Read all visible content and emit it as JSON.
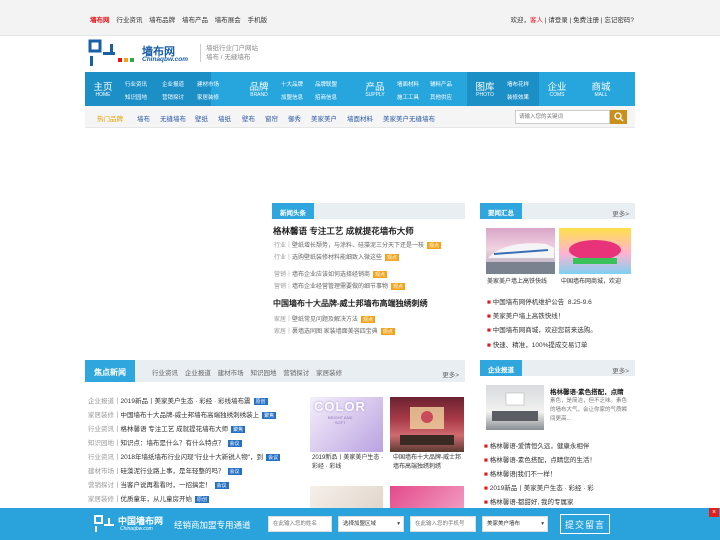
{
  "topbar": {
    "links": [
      "墙布网",
      "行业资讯",
      "墙布品牌",
      "墙布产品",
      "墙布展会",
      "手机版"
    ],
    "welcome": "欢迎，",
    "guest": "客人",
    "sep1": "| 请登录 |",
    "register": "免费注册",
    "forgot": "| 忘记密码?"
  },
  "logo": {
    "cn": "墙布网",
    "en": "Chinaqbw.com",
    "slogan_1": "墙纸行业门户网站",
    "slogan_2": "墙布 / 无缝墙布"
  },
  "nav": [
    {
      "label": "主页",
      "sub": "HOME",
      "items": [
        "行业资讯",
        "企业报道",
        "建材市场",
        "知识园地",
        "营销探讨",
        "家居装修"
      ]
    },
    {
      "label": "品牌",
      "sub": "BRAND",
      "items": [
        "十大品牌",
        "品牌联盟",
        "加盟信息",
        "招商信息"
      ]
    },
    {
      "label": "产品",
      "sub": "SUPPLY",
      "items": [
        "墙面材料",
        "辅料产品",
        "施工工具",
        "其他供应"
      ]
    },
    {
      "label": "图库",
      "sub": "PHOTO",
      "items": [
        "墙布花样",
        "装修效果"
      ]
    },
    {
      "label": "企业",
      "sub": "COMS",
      "items": []
    },
    {
      "label": "商城",
      "sub": "MALL",
      "items": []
    }
  ],
  "subnav": {
    "hot": "热门品牌",
    "items": [
      "墙布",
      "无缝墙布",
      "壁纸",
      "墙纸",
      "壁布",
      "窗帘",
      "御秀",
      "美家美户",
      "墙面材料",
      "美家美户无缝墙布"
    ],
    "search_placeholder": "请输入您的关键词"
  },
  "headline": {
    "tab": "新闻头条",
    "h1": "格林馨语 专注工艺 成就提花墙布大师",
    "rows1": [
      {
        "cat": "行业",
        "text": "壁纸增长颓势，与涂料、硅藻泥三分天下还是一枝",
        "badge": "观点"
      },
      {
        "cat": "行业",
        "text": "选购壁纸装修材料能细致入微这些",
        "badge": "观点"
      }
    ],
    "rows2": [
      {
        "cat": "营销",
        "text": "墙布企业应该如何选择经销商",
        "badge": "观点"
      },
      {
        "cat": "营销",
        "text": "墙布企业经营管理需要做的细节事物",
        "badge": "观点"
      }
    ],
    "h2": "中国墙布十大品牌-威士邦墙布高端独绣刺绣",
    "rows3": [
      {
        "cat": "家居",
        "text": "壁纸常见问题及解决方法",
        "badge": "观点"
      },
      {
        "cat": "家居",
        "text": "裹墙选同图 家装墙面美容四宝典",
        "badge": "观点"
      }
    ]
  },
  "roundup": {
    "tab": "要闻汇总",
    "more": "更多>",
    "caps": [
      "美家美户墙上高铁快线",
      "中国墙布网商城，欢迎"
    ],
    "items": [
      {
        "text": "中国墙布网停机维护公告",
        "date": "8.25-9.6"
      },
      {
        "text": "美家美户墙上高铁快线！",
        "date": ""
      },
      {
        "text": "中国墙布网商城，欢迎您前来选购。",
        "date": ""
      },
      {
        "text": "快速、精准，100%提成交易订单",
        "date": ""
      }
    ]
  },
  "news": {
    "tab": "焦点新闻",
    "tabs": [
      "行业资讯",
      "企业报道",
      "建材市场",
      "知识园地",
      "营销探讨",
      "家居装修"
    ],
    "more": "更多>",
    "rows": [
      {
        "cat": "企业报道",
        "text": "2019新品丨美家美户生态 · 彩经 · 彩线墙布震",
        "badge": "原创",
        "blue": true
      },
      {
        "cat": "家居装修",
        "text": "中国墙布十大品牌-威士邦墙布高端独绣刺绣装上",
        "badge": "聚焦",
        "blue": true
      },
      {
        "cat": "行业资讯",
        "text": "格林馨语 专注工艺 成就提花墙布大师",
        "badge": "聚焦",
        "blue": true
      },
      {
        "cat": "知识园地",
        "text": "知识点：墙布是什么？有什么特点？",
        "badge": "会议",
        "blue": true
      },
      {
        "cat": "行业资讯",
        "text": "2018年墙纸墙布行业闪现\"行业十大新锐人物\"，到",
        "badge": "会议",
        "blue": true
      },
      {
        "cat": "建材市场",
        "text": "硅藻泥行业路上事，是年轻整的吗？",
        "badge": "会议",
        "blue": true
      },
      {
        "cat": "营销探讨",
        "text": "当客户说再看看时，一招搞定！",
        "badge": "会议",
        "blue": true
      },
      {
        "cat": "家居装修",
        "text": "优质童年，从儿童房开始",
        "badge": "原创",
        "blue": true
      }
    ],
    "thumb_caps": [
      "2019新品丨美家美户生态 · 彩经 · 彩线",
      "中国墙布十大品牌-威士邦墙布高端独绣刺绣"
    ],
    "color_word": "COLOR",
    "color_sub": "BRIGHT AND\nSOFT"
  },
  "enterprise": {
    "tab": "企业报道",
    "more": "更多>",
    "feature_title": "格林馨语-素色搭配，点睛",
    "feature_text": "素色，是简洁，但不乏味。素色的墙布大气，会让你家的气质瞬间更高...",
    "items": [
      "格林馨语-爱情恒久远，健康永相伴",
      "格林馨语-素色搭配，点睛您的生活！",
      "格林馨语|我们不一样！",
      "2019新品丨美家美户生态 · 彩经 · 彩",
      "格林馨语-都甜好, 我的专属家"
    ]
  },
  "footer": {
    "logo_cn": "中国墙布网",
    "logo_en": "Chinaqbw.com",
    "label": "经销商加盟专用通道",
    "name_placeholder": "在此输入您的姓名",
    "region": "选择加盟区域",
    "phone_placeholder": "在此输入您的手机号",
    "brand": "美家美户墙布",
    "submit": "提交留言",
    "close": "×"
  },
  "colors": {
    "accent": "#27a5dd",
    "brand_red": "#e4141b",
    "badge_orange": "#f3a31b",
    "badge_blue": "#2670c4"
  }
}
